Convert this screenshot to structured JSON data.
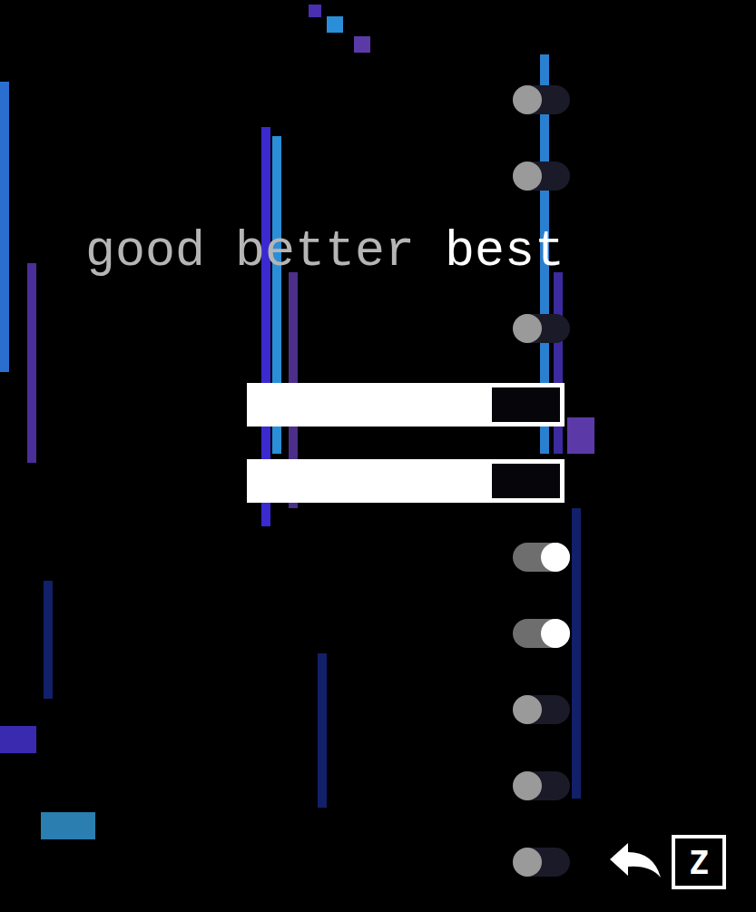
{
  "settings": [
    {
      "kind": "toggle",
      "on": false
    },
    {
      "kind": "toggle",
      "on": false
    },
    {
      "kind": "choice",
      "options": [
        {
          "label": "good",
          "selected": false
        },
        {
          "label": "better",
          "selected": false
        },
        {
          "label": "best",
          "selected": true
        }
      ]
    },
    {
      "kind": "toggle",
      "on": false
    },
    {
      "kind": "slider",
      "level": 0.78
    },
    {
      "kind": "slider",
      "level": 0.78
    },
    {
      "kind": "toggle",
      "on": true
    },
    {
      "kind": "toggle",
      "on": true
    },
    {
      "kind": "toggle",
      "on": false
    },
    {
      "kind": "toggle",
      "on": false
    },
    {
      "kind": "toggle",
      "on": false
    }
  ],
  "back_hint": {
    "key": "Z"
  }
}
